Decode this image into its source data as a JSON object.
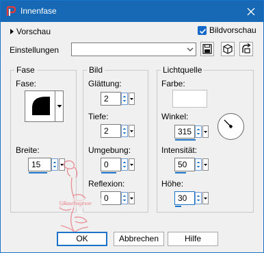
{
  "window": {
    "title": "Innenfase"
  },
  "preview_toggle": {
    "label": "Vorschau"
  },
  "bildvorschau": {
    "label": "Bildvorschau",
    "checked": true
  },
  "settings": {
    "label": "Einstellungen",
    "value": ""
  },
  "groups": {
    "fase": {
      "title": "Fase",
      "fase_label": "Fase:",
      "breite_label": "Breite:",
      "breite_value": "15"
    },
    "bild": {
      "title": "Bild",
      "glaettung_label": "Glättung:",
      "glaettung_value": "2",
      "tiefe_label": "Tiefe:",
      "tiefe_value": "2",
      "umgebung_label": "Umgebung:",
      "umgebung_value": "0",
      "reflexion_label": "Reflexion:",
      "reflexion_value": "0"
    },
    "licht": {
      "title": "Lichtquelle",
      "farbe_label": "Farbe:",
      "farbe_color": "#ffffff",
      "winkel_label": "Winkel:",
      "winkel_value": "315",
      "intensitaet_label": "Intensität:",
      "intensitaet_value": "50",
      "hoehe_label": "Höhe:",
      "hoehe_value": "30"
    }
  },
  "buttons": {
    "ok": "OK",
    "cancel": "Abbrechen",
    "help": "Hilfe"
  },
  "colors": {
    "titlebar": "#1769b5",
    "accent": "#1a73c9",
    "watermark": "#e8828a"
  }
}
